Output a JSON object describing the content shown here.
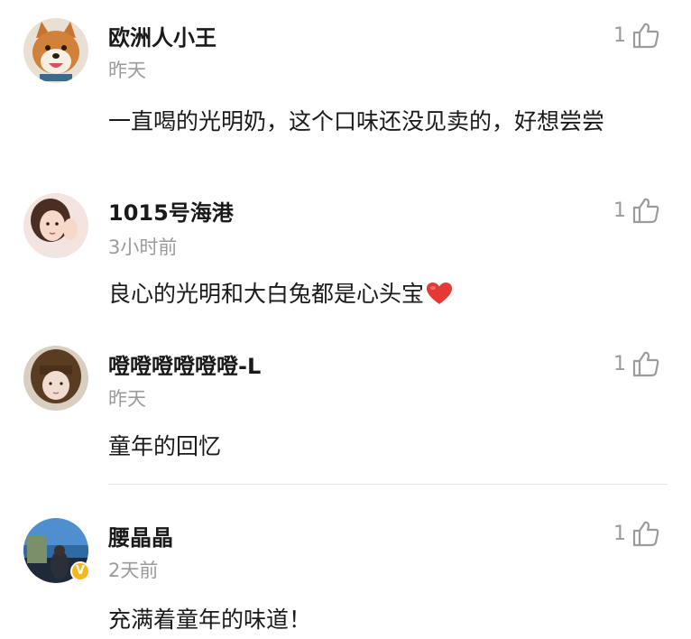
{
  "comments": [
    {
      "username": "欧洲人小王",
      "time": "昨天",
      "likes": "1",
      "text": "一直喝的光明奶，这个口味还没见卖的，好想尝尝",
      "avatar": "shiba-dog-avatar",
      "verified": false
    },
    {
      "username": "1015号海港",
      "time": "3小时前",
      "likes": "1",
      "text": "良心的光明和大白兔都是心头宝",
      "emoji": "red-heart-emoji",
      "avatar": "girl-portrait-avatar",
      "verified": false
    },
    {
      "username": "噔噔噔噔噔噔-L",
      "time": "昨天",
      "likes": "1",
      "text": "童年的回忆",
      "avatar": "bob-hair-girl-avatar",
      "verified": false
    },
    {
      "username": "腰晶晶",
      "time": "2天前",
      "likes": "1",
      "text": "充满着童年的味道！",
      "avatar": "seaside-photo-avatar",
      "verified": true,
      "badge": "V"
    }
  ],
  "colors": {
    "text": "#1a1a1a",
    "muted": "#9b9b9b",
    "divider": "#e5e5e5",
    "heart": "#e53935",
    "verified_badge": "#f5b71c"
  }
}
